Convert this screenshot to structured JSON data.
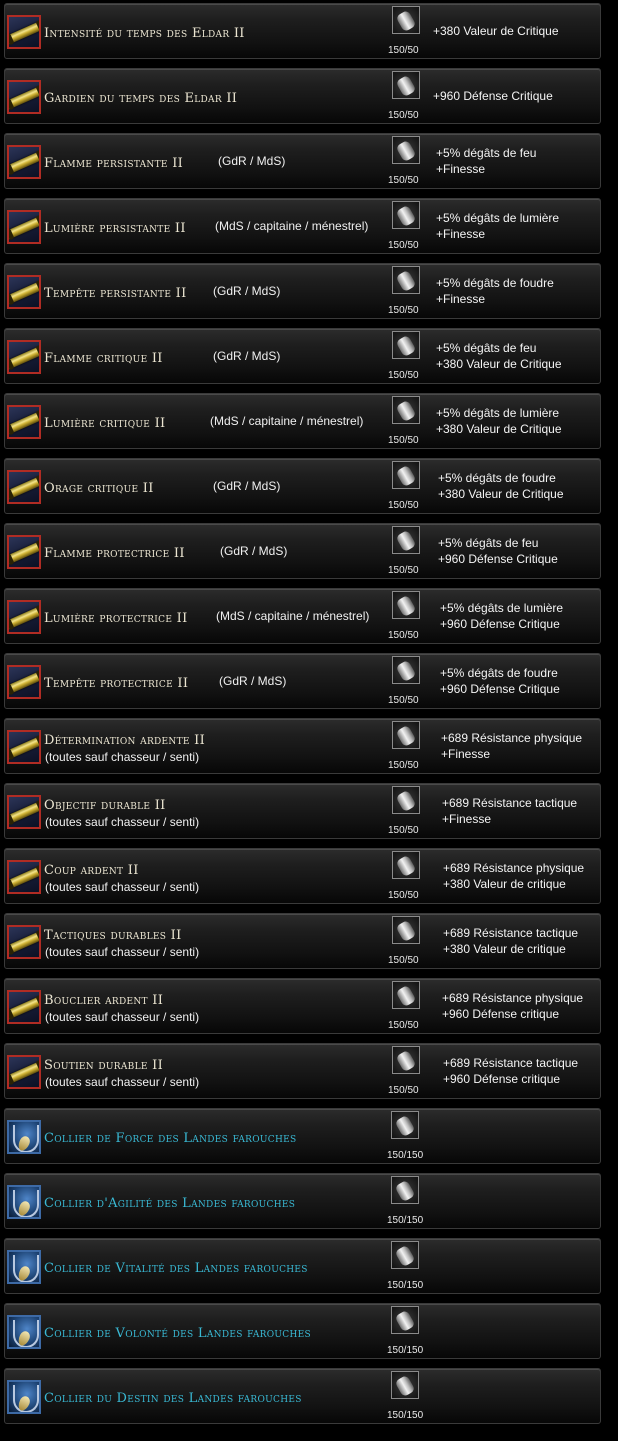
{
  "rows": [
    {
      "icon": "scroll",
      "name": "Intensité du temps des Eldar II",
      "count": "150/50",
      "effects": [
        "+380 Valeur de Critique"
      ]
    },
    {
      "icon": "scroll",
      "name": "Gardien du temps des Eldar II",
      "count": "150/50",
      "effects": [
        "+960 Défense Critique"
      ]
    },
    {
      "icon": "scroll",
      "name": "Flamme persistante II",
      "tag": "(GdR / MdS)",
      "count": "150/50",
      "effects": [
        "+5% dégâts de feu",
        "+Finesse"
      ]
    },
    {
      "icon": "scroll",
      "name": "Lumière persistante II",
      "tag": "(MdS / capitaine / ménestrel)",
      "count": "150/50",
      "effects": [
        "+5% dégâts de lumière",
        "+Finesse"
      ]
    },
    {
      "icon": "scroll",
      "name": "Tempête persistante II",
      "tag": "(GdR / MdS)",
      "count": "150/50",
      "effects": [
        "+5% dégâts de foudre",
        "+Finesse"
      ]
    },
    {
      "icon": "scroll",
      "name": "Flamme critique II",
      "tag": "(GdR / MdS)",
      "count": "150/50",
      "effects": [
        "+5% dégâts de feu",
        "+380 Valeur de Critique"
      ]
    },
    {
      "icon": "scroll",
      "name": "Lumière critique II",
      "tag": "(MdS / capitaine / ménestrel)",
      "count": "150/50",
      "effects": [
        "+5% dégâts de lumière",
        "+380 Valeur de Critique"
      ]
    },
    {
      "icon": "scroll",
      "name": "Orage critique II",
      "tag": "(GdR / MdS)",
      "count": "150/50",
      "effects": [
        "+5% dégâts de foudre",
        "+380 Valeur de Critique"
      ]
    },
    {
      "icon": "scroll",
      "name": "Flamme protectrice II",
      "tag": "(GdR / MdS)",
      "count": "150/50",
      "effects": [
        "+5% dégâts de feu",
        "+960 Défense Critique"
      ]
    },
    {
      "icon": "scroll",
      "name": "Lumière protectrice II",
      "tag": "(MdS / capitaine / ménestrel)",
      "count": "150/50",
      "effects": [
        "+5% dégâts de lumière",
        "+960 Défense Critique"
      ]
    },
    {
      "icon": "scroll",
      "name": "Tempête protectrice II",
      "tag": "(GdR / MdS)",
      "count": "150/50",
      "effects": [
        "+5% dégâts de foudre",
        "+960 Défense Critique"
      ]
    },
    {
      "icon": "scroll",
      "name": "Détermination ardente II",
      "sub": "(toutes sauf chasseur / senti)",
      "count": "150/50",
      "effects": [
        "+689 Résistance physique",
        "+Finesse"
      ]
    },
    {
      "icon": "scroll",
      "name": "Objectif durable II",
      "sub": "(toutes sauf chasseur / senti)",
      "count": "150/50",
      "effects": [
        "+689 Résistance tactique",
        "+Finesse"
      ]
    },
    {
      "icon": "scroll",
      "name": "Coup ardent II",
      "sub": "(toutes sauf chasseur / senti)",
      "count": "150/50",
      "effects": [
        "+689 Résistance physique",
        "+380 Valeur de critique"
      ]
    },
    {
      "icon": "scroll",
      "name": "Tactiques durables II",
      "sub": "(toutes sauf chasseur / senti)",
      "count": "150/50",
      "effects": [
        "+689 Résistance tactique",
        "+380 Valeur de critique"
      ]
    },
    {
      "icon": "scroll",
      "name": "Bouclier ardent II",
      "sub": "(toutes sauf chasseur / senti)",
      "count": "150/50",
      "effects": [
        "+689 Résistance physique",
        "+960 Défense critique"
      ]
    },
    {
      "icon": "scroll",
      "name": "Soutien durable II",
      "sub": "(toutes sauf chasseur / senti)",
      "count": "150/50",
      "effects": [
        "+689 Résistance tactique",
        "+960 Défense critique"
      ]
    },
    {
      "icon": "necklace",
      "name": "Collier de Force des Landes farouches",
      "count": "150/150",
      "effects": []
    },
    {
      "icon": "necklace",
      "name": "Collier d'Agilité des Landes farouches",
      "count": "150/150",
      "effects": []
    },
    {
      "icon": "necklace",
      "name": "Collier de Vitalité des Landes farouches",
      "count": "150/150",
      "effects": []
    },
    {
      "icon": "necklace",
      "name": "Collier de Volonté des Landes farouches",
      "count": "150/150",
      "effects": []
    },
    {
      "icon": "necklace",
      "name": "Collier du Destin des Landes farouches",
      "count": "150/150",
      "effects": []
    }
  ]
}
